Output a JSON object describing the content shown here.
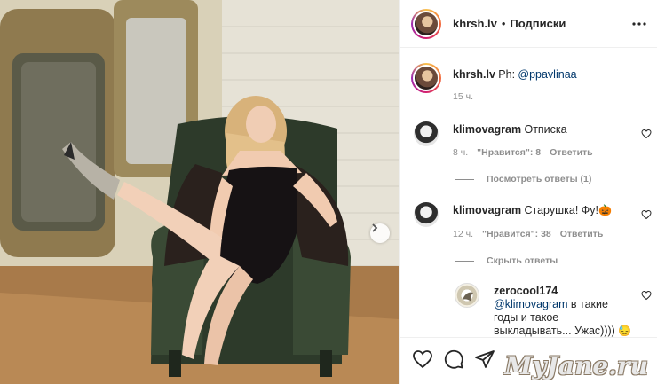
{
  "post": {
    "username": "khrsh.lv",
    "separator": "•",
    "follow_label": "Подписки",
    "caption_prefix": "Ph:",
    "caption_mention": "@ppavlinaa",
    "caption_time": "15 ч."
  },
  "comments": [
    {
      "user": "klimovagram",
      "text": "Отписка",
      "time": "8 ч.",
      "likes": "\"Нравится\": 8",
      "reply_label": "Ответить",
      "toggle_label": "Посмотреть ответы (1)"
    },
    {
      "user": "klimovagram",
      "text": "Старушка! Фу!",
      "emoji": "🎃",
      "time": "12 ч.",
      "likes": "\"Нравится\": 38",
      "reply_label": "Ответить",
      "toggle_label": "Скрыть ответы"
    }
  ],
  "reply": {
    "user": "zerocool174",
    "mention": "@klimovagram",
    "text_line1": "в такие",
    "text_line2": "годы и такое",
    "text_line3": "выкладывать... Ужас))))",
    "emoji": "😓"
  },
  "icons": {
    "more": "more-horizontal-icon",
    "like": "heart-icon",
    "comment": "comment-icon",
    "share": "share-icon",
    "next": "chevron-right-icon"
  },
  "watermark": "MyJane.ru"
}
